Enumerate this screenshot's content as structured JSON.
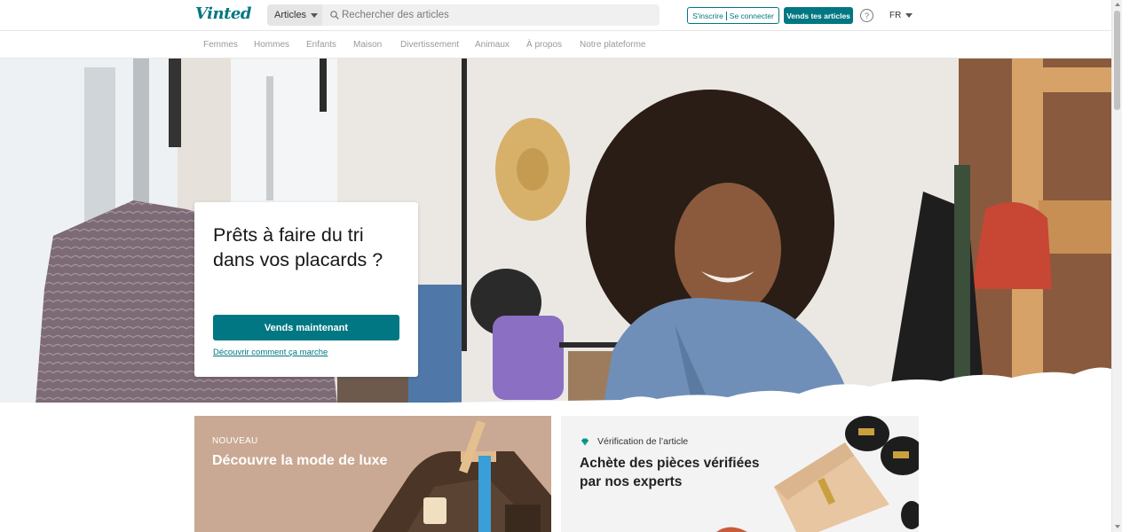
{
  "header": {
    "logo": "Vinted",
    "search_category": "Articles",
    "search_placeholder": "Rechercher des articles",
    "signup_label": "S'inscrire",
    "login_label": "Se connecter",
    "sell_label": "Vends tes articles",
    "help_glyph": "?",
    "language": "FR"
  },
  "nav": {
    "items": [
      {
        "label": "Femmes"
      },
      {
        "label": "Hommes"
      },
      {
        "label": "Enfants"
      },
      {
        "label": "Maison"
      },
      {
        "label": "Divertissement"
      },
      {
        "label": "Animaux"
      },
      {
        "label": "À propos"
      },
      {
        "label": "Notre plateforme"
      }
    ]
  },
  "hero": {
    "title": "Prêts à faire du tri dans vos placards ?",
    "cta_label": "Vends maintenant",
    "link_label": "Découvrir comment ça marche"
  },
  "promos": {
    "luxe": {
      "tag": "NOUVEAU",
      "title": "Découvre la mode de luxe"
    },
    "verification": {
      "tag": "Vérification de l’article",
      "title": "Achète des pièces vérifiées par nos experts"
    }
  },
  "colors": {
    "brand": "#007782",
    "luxe_background": "#c9a993",
    "verification_background": "#f3f3f3"
  },
  "icons": {
    "search": "search-icon",
    "help": "help-icon",
    "dropdown": "caret-down-icon",
    "gem": "gem-icon"
  }
}
